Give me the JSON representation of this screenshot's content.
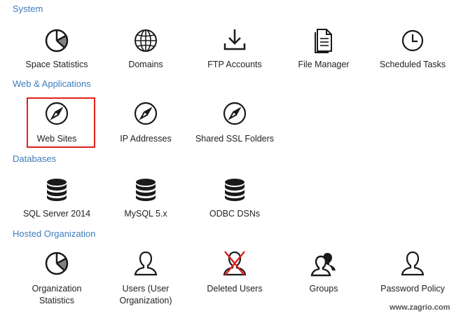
{
  "sections": [
    {
      "title": "System",
      "items": [
        {
          "label": "Space Statistics",
          "icon": "pie-chart-icon"
        },
        {
          "label": "Domains",
          "icon": "globe-icon"
        },
        {
          "label": "FTP Accounts",
          "icon": "download-icon"
        },
        {
          "label": "File Manager",
          "icon": "document-icon"
        },
        {
          "label": "Scheduled Tasks",
          "icon": "clock-icon"
        }
      ]
    },
    {
      "title": "Web & Applications",
      "items": [
        {
          "label": "Web Sites",
          "icon": "compass-icon",
          "highlighted": true
        },
        {
          "label": "IP Addresses",
          "icon": "compass-icon"
        },
        {
          "label": "Shared SSL Folders",
          "icon": "compass-icon"
        }
      ]
    },
    {
      "title": "Databases",
      "items": [
        {
          "label": "SQL Server 2014",
          "icon": "database-icon"
        },
        {
          "label": "MySQL 5.x",
          "icon": "database-icon"
        },
        {
          "label": "ODBC DSNs",
          "icon": "database-icon"
        }
      ]
    },
    {
      "title": "Hosted Organization",
      "items": [
        {
          "label": "Organization\nStatistics",
          "icon": "pie-chart-icon"
        },
        {
          "label": "Users (User\nOrganization)",
          "icon": "user-icon"
        },
        {
          "label": "Deleted Users",
          "icon": "deleted-user-icon"
        },
        {
          "label": "Groups",
          "icon": "group-icon"
        },
        {
          "label": "Password Policy",
          "icon": "user-icon"
        }
      ]
    }
  ],
  "watermark": "www.zagrio.com",
  "colors": {
    "section_title": "#3c7dbd",
    "highlight": "#e0201b",
    "icon": "#1a1a1a",
    "delete_mark": "#e0201b"
  }
}
